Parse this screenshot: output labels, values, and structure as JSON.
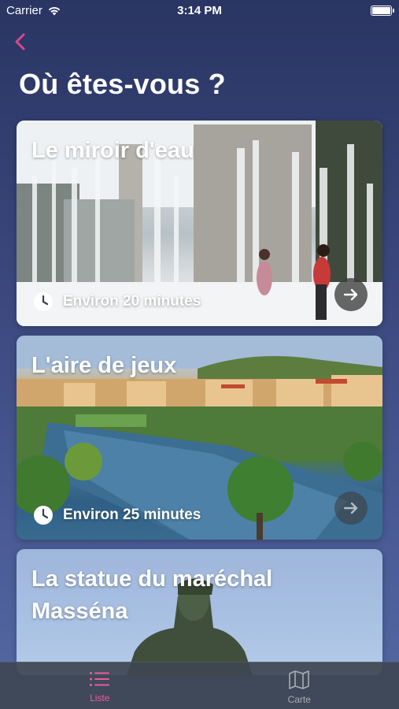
{
  "status_bar": {
    "carrier": "Carrier",
    "time": "3:14 PM"
  },
  "navigation": {
    "back_icon": "chevron-left-icon",
    "accent_color": "#d94a8a"
  },
  "page": {
    "title": "Où êtes-vous ?"
  },
  "places": [
    {
      "title": "Le miroir d'eau",
      "duration": "Environ 20 minutes",
      "go_icon": "arrow-right-icon"
    },
    {
      "title": "L'aire de jeux",
      "duration": "Environ 25 minutes",
      "go_icon": "arrow-right-icon"
    },
    {
      "title": "La statue du maréchal Masséna"
    }
  ],
  "tab_bar": {
    "tabs": [
      {
        "label": "Liste",
        "icon": "list-icon",
        "active": true
      },
      {
        "label": "Carte",
        "icon": "map-icon",
        "active": false
      }
    ],
    "active_color": "#e85c9a"
  }
}
